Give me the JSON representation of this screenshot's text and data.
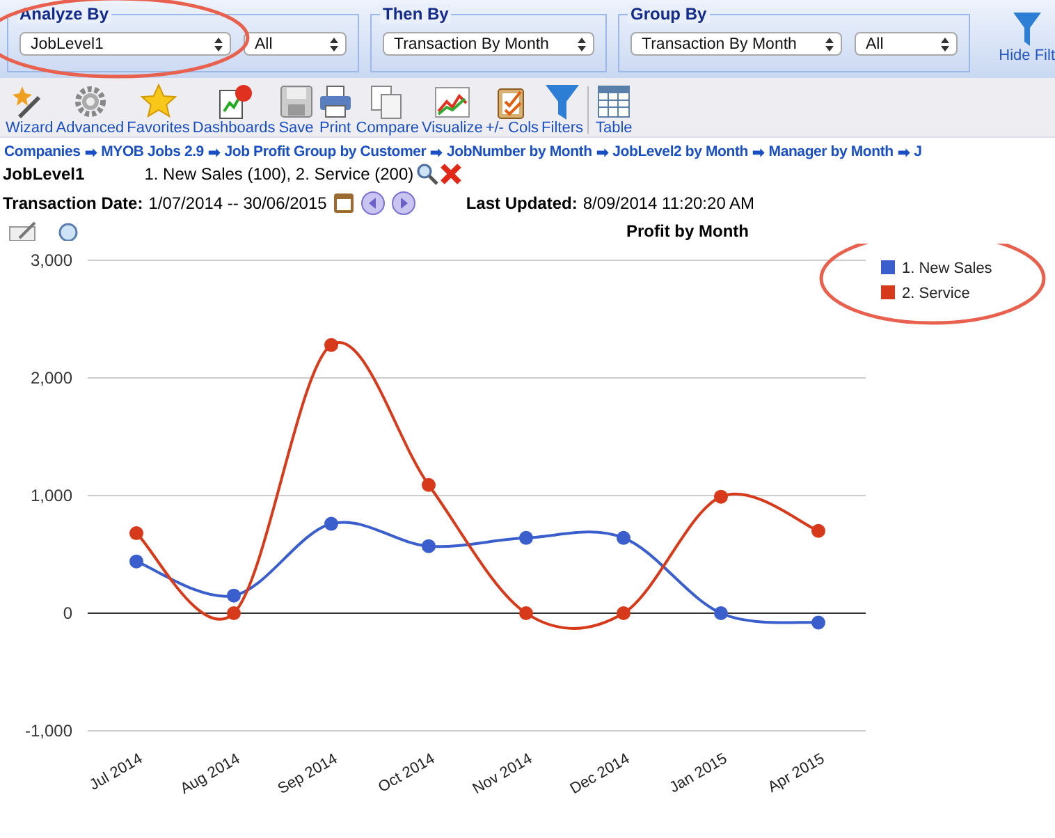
{
  "filter_groups": [
    {
      "legend": "Analyze By",
      "highlighted": true,
      "dropdowns": [
        {
          "value": "JobLevel1"
        },
        {
          "value": "All"
        }
      ]
    },
    {
      "legend": "Then By",
      "highlighted": false,
      "dropdowns": [
        {
          "value": "Transaction By Month"
        }
      ]
    },
    {
      "legend": "Group By",
      "highlighted": false,
      "dropdowns": [
        {
          "value": "Transaction By Month"
        },
        {
          "value": "All"
        }
      ]
    }
  ],
  "hide_filters": {
    "label": "Hide Filt"
  },
  "toolbar": [
    {
      "label": "Wizard",
      "kind": "wizard"
    },
    {
      "label": "Advanced",
      "kind": "gear"
    },
    {
      "label": "Favorites",
      "kind": "star"
    },
    {
      "label": "Dashboards",
      "kind": "dashboard"
    },
    {
      "label": "Save",
      "kind": "save"
    },
    {
      "label": "Print",
      "kind": "print"
    },
    {
      "label": "Compare",
      "kind": "compare"
    },
    {
      "label": "Visualize",
      "kind": "chart"
    },
    {
      "label": "+/- Cols",
      "kind": "clipboard"
    },
    {
      "label": "Filters",
      "kind": "funnel"
    },
    {
      "label": "Table",
      "kind": "table",
      "separated": true
    }
  ],
  "breadcrumb": {
    "separator": "➡",
    "items": [
      "Companies",
      "MYOB Jobs 2.9",
      "Job Profit Group by Customer",
      "JobNumber by Month",
      "JobLevel2 by Month",
      "Manager by Month",
      "J"
    ]
  },
  "active_filter": {
    "label": "JobLevel1",
    "value": "1. New Sales (100), 2. Service (200)"
  },
  "date_row": {
    "label": "Transaction Date:",
    "value": "1/07/2014 -- 30/06/2015",
    "updated_label": "Last Updated:",
    "updated_value": "8/09/2014 11:20:20 AM"
  },
  "chart": {
    "chart_data": {
      "type": "line",
      "title": "Profit by Month",
      "categories": [
        "Jul 2014",
        "Aug 2014",
        "Sep 2014",
        "Oct 2014",
        "Nov 2014",
        "Dec 2014",
        "Jan 2015",
        "Apr 2015"
      ],
      "series": [
        {
          "name": "1. New Sales",
          "color": "#3a5fcd",
          "marker": "circle",
          "values": [
            440,
            150,
            760,
            570,
            640,
            640,
            0,
            -80
          ]
        },
        {
          "name": "2. Service",
          "color": "#d63a1a",
          "marker": "circle",
          "values": [
            680,
            0,
            2280,
            1090,
            0,
            0,
            990,
            700
          ]
        }
      ],
      "legend": true,
      "ylim": [
        -1000,
        3000
      ],
      "yticks": [
        {
          "value": -1000,
          "label": "-1,000"
        },
        {
          "value": 0,
          "label": "0"
        },
        {
          "value": 1000,
          "label": "1,000"
        },
        {
          "value": 2000,
          "label": "2,000"
        },
        {
          "value": 3000,
          "label": "3,000"
        }
      ]
    },
    "legend_highlighted": true
  }
}
